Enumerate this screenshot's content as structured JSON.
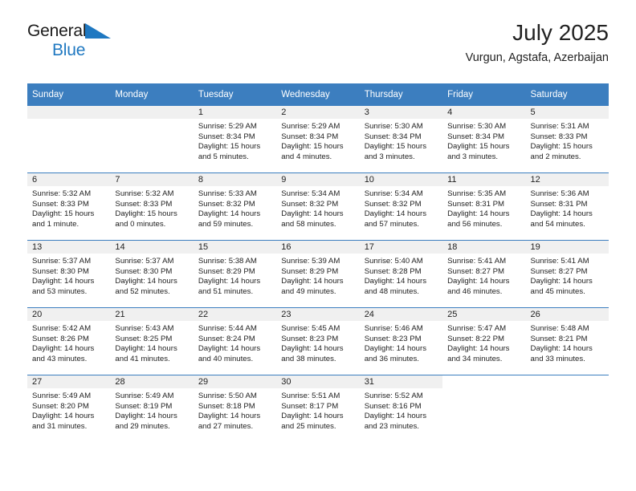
{
  "brand": {
    "word_general": "General",
    "word_blue": "Blue",
    "triangle_color": "#1f78c1"
  },
  "header": {
    "title": "July 2025",
    "subtitle": "Vurgun, Agstafa, Azerbaijan"
  },
  "theme": {
    "header_blue": "#3c7ebf",
    "band_gray": "#f0f0f0",
    "text": "#222222"
  },
  "weekdays": [
    "Sunday",
    "Monday",
    "Tuesday",
    "Wednesday",
    "Thursday",
    "Friday",
    "Saturday"
  ],
  "weeks": [
    [
      {
        "day": "",
        "sunrise": "",
        "sunset": "",
        "daylight": "",
        "empty": true
      },
      {
        "day": "",
        "sunrise": "",
        "sunset": "",
        "daylight": "",
        "empty": true
      },
      {
        "day": "1",
        "sunrise": "Sunrise: 5:29 AM",
        "sunset": "Sunset: 8:34 PM",
        "daylight": "Daylight: 15 hours and 5 minutes."
      },
      {
        "day": "2",
        "sunrise": "Sunrise: 5:29 AM",
        "sunset": "Sunset: 8:34 PM",
        "daylight": "Daylight: 15 hours and 4 minutes."
      },
      {
        "day": "3",
        "sunrise": "Sunrise: 5:30 AM",
        "sunset": "Sunset: 8:34 PM",
        "daylight": "Daylight: 15 hours and 3 minutes."
      },
      {
        "day": "4",
        "sunrise": "Sunrise: 5:30 AM",
        "sunset": "Sunset: 8:34 PM",
        "daylight": "Daylight: 15 hours and 3 minutes."
      },
      {
        "day": "5",
        "sunrise": "Sunrise: 5:31 AM",
        "sunset": "Sunset: 8:33 PM",
        "daylight": "Daylight: 15 hours and 2 minutes."
      }
    ],
    [
      {
        "day": "6",
        "sunrise": "Sunrise: 5:32 AM",
        "sunset": "Sunset: 8:33 PM",
        "daylight": "Daylight: 15 hours and 1 minute."
      },
      {
        "day": "7",
        "sunrise": "Sunrise: 5:32 AM",
        "sunset": "Sunset: 8:33 PM",
        "daylight": "Daylight: 15 hours and 0 minutes."
      },
      {
        "day": "8",
        "sunrise": "Sunrise: 5:33 AM",
        "sunset": "Sunset: 8:32 PM",
        "daylight": "Daylight: 14 hours and 59 minutes."
      },
      {
        "day": "9",
        "sunrise": "Sunrise: 5:34 AM",
        "sunset": "Sunset: 8:32 PM",
        "daylight": "Daylight: 14 hours and 58 minutes."
      },
      {
        "day": "10",
        "sunrise": "Sunrise: 5:34 AM",
        "sunset": "Sunset: 8:32 PM",
        "daylight": "Daylight: 14 hours and 57 minutes."
      },
      {
        "day": "11",
        "sunrise": "Sunrise: 5:35 AM",
        "sunset": "Sunset: 8:31 PM",
        "daylight": "Daylight: 14 hours and 56 minutes."
      },
      {
        "day": "12",
        "sunrise": "Sunrise: 5:36 AM",
        "sunset": "Sunset: 8:31 PM",
        "daylight": "Daylight: 14 hours and 54 minutes."
      }
    ],
    [
      {
        "day": "13",
        "sunrise": "Sunrise: 5:37 AM",
        "sunset": "Sunset: 8:30 PM",
        "daylight": "Daylight: 14 hours and 53 minutes."
      },
      {
        "day": "14",
        "sunrise": "Sunrise: 5:37 AM",
        "sunset": "Sunset: 8:30 PM",
        "daylight": "Daylight: 14 hours and 52 minutes."
      },
      {
        "day": "15",
        "sunrise": "Sunrise: 5:38 AM",
        "sunset": "Sunset: 8:29 PM",
        "daylight": "Daylight: 14 hours and 51 minutes."
      },
      {
        "day": "16",
        "sunrise": "Sunrise: 5:39 AM",
        "sunset": "Sunset: 8:29 PM",
        "daylight": "Daylight: 14 hours and 49 minutes."
      },
      {
        "day": "17",
        "sunrise": "Sunrise: 5:40 AM",
        "sunset": "Sunset: 8:28 PM",
        "daylight": "Daylight: 14 hours and 48 minutes."
      },
      {
        "day": "18",
        "sunrise": "Sunrise: 5:41 AM",
        "sunset": "Sunset: 8:27 PM",
        "daylight": "Daylight: 14 hours and 46 minutes."
      },
      {
        "day": "19",
        "sunrise": "Sunrise: 5:41 AM",
        "sunset": "Sunset: 8:27 PM",
        "daylight": "Daylight: 14 hours and 45 minutes."
      }
    ],
    [
      {
        "day": "20",
        "sunrise": "Sunrise: 5:42 AM",
        "sunset": "Sunset: 8:26 PM",
        "daylight": "Daylight: 14 hours and 43 minutes."
      },
      {
        "day": "21",
        "sunrise": "Sunrise: 5:43 AM",
        "sunset": "Sunset: 8:25 PM",
        "daylight": "Daylight: 14 hours and 41 minutes."
      },
      {
        "day": "22",
        "sunrise": "Sunrise: 5:44 AM",
        "sunset": "Sunset: 8:24 PM",
        "daylight": "Daylight: 14 hours and 40 minutes."
      },
      {
        "day": "23",
        "sunrise": "Sunrise: 5:45 AM",
        "sunset": "Sunset: 8:23 PM",
        "daylight": "Daylight: 14 hours and 38 minutes."
      },
      {
        "day": "24",
        "sunrise": "Sunrise: 5:46 AM",
        "sunset": "Sunset: 8:23 PM",
        "daylight": "Daylight: 14 hours and 36 minutes."
      },
      {
        "day": "25",
        "sunrise": "Sunrise: 5:47 AM",
        "sunset": "Sunset: 8:22 PM",
        "daylight": "Daylight: 14 hours and 34 minutes."
      },
      {
        "day": "26",
        "sunrise": "Sunrise: 5:48 AM",
        "sunset": "Sunset: 8:21 PM",
        "daylight": "Daylight: 14 hours and 33 minutes."
      }
    ],
    [
      {
        "day": "27",
        "sunrise": "Sunrise: 5:49 AM",
        "sunset": "Sunset: 8:20 PM",
        "daylight": "Daylight: 14 hours and 31 minutes."
      },
      {
        "day": "28",
        "sunrise": "Sunrise: 5:49 AM",
        "sunset": "Sunset: 8:19 PM",
        "daylight": "Daylight: 14 hours and 29 minutes."
      },
      {
        "day": "29",
        "sunrise": "Sunrise: 5:50 AM",
        "sunset": "Sunset: 8:18 PM",
        "daylight": "Daylight: 14 hours and 27 minutes."
      },
      {
        "day": "30",
        "sunrise": "Sunrise: 5:51 AM",
        "sunset": "Sunset: 8:17 PM",
        "daylight": "Daylight: 14 hours and 25 minutes."
      },
      {
        "day": "31",
        "sunrise": "Sunrise: 5:52 AM",
        "sunset": "Sunset: 8:16 PM",
        "daylight": "Daylight: 14 hours and 23 minutes."
      },
      {
        "day": "",
        "sunrise": "",
        "sunset": "",
        "daylight": "",
        "blank": true
      },
      {
        "day": "",
        "sunrise": "",
        "sunset": "",
        "daylight": "",
        "blank": true
      }
    ]
  ]
}
